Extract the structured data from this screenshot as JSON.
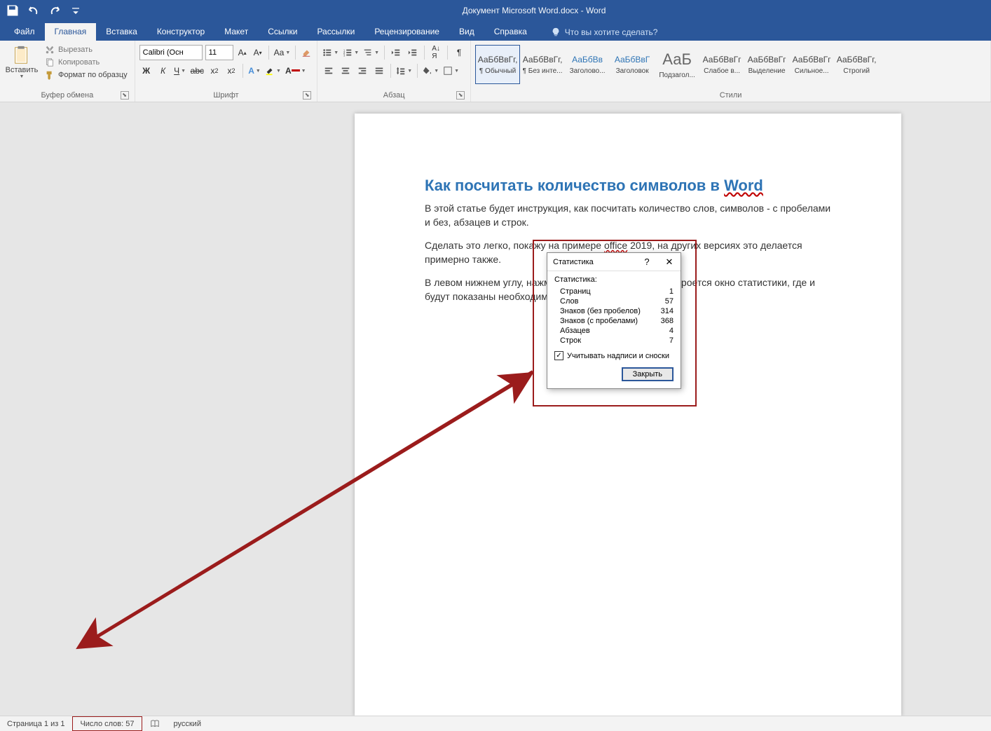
{
  "titlebar": {
    "title": "Документ Microsoft Word.docx  -  Word"
  },
  "tabs": {
    "file": "Файл",
    "items": [
      "Главная",
      "Вставка",
      "Конструктор",
      "Макет",
      "Ссылки",
      "Рассылки",
      "Рецензирование",
      "Вид",
      "Справка"
    ],
    "active": 0,
    "tell_me": "Что вы хотите сделать?"
  },
  "clipboard": {
    "paste": "Вставить",
    "cut": "Вырезать",
    "copy": "Копировать",
    "format_painter": "Формат по образцу",
    "label": "Буфер обмена"
  },
  "font": {
    "name": "Calibri (Осн",
    "size": "11",
    "label": "Шрифт"
  },
  "paragraph": {
    "label": "Абзац"
  },
  "styles": {
    "label": "Стили",
    "items": [
      {
        "preview": "АаБбВвГг,",
        "name": "¶ Обычный",
        "sel": true,
        "cls": ""
      },
      {
        "preview": "АаБбВвГг,",
        "name": "¶ Без инте...",
        "cls": ""
      },
      {
        "preview": "АаБбВв",
        "name": "Заголово...",
        "cls": "blue"
      },
      {
        "preview": "АаБбВвГ",
        "name": "Заголовок",
        "cls": "blue"
      },
      {
        "preview": "АаБ",
        "name": "Подзагол...",
        "cls": "big"
      },
      {
        "preview": "АаБбВвГг",
        "name": "Слабое в...",
        "cls": ""
      },
      {
        "preview": "АаБбВвГг",
        "name": "Выделение",
        "cls": ""
      },
      {
        "preview": "АаБбВвГг",
        "name": "Сильное...",
        "cls": ""
      },
      {
        "preview": "АаБбВвГг,",
        "name": "Строгий",
        "cls": ""
      }
    ]
  },
  "document": {
    "title_pre": "Как посчитать количество символов в ",
    "title_ul": "Word",
    "p1": "В этой статье будет инструкция, как посчитать количество слов, символов - с пробелами и без, абзацев и строк.",
    "p2_pre": "Сделать это легко, покажу на примере ",
    "p2_ul": "office",
    "p2_post": " 2019, на других версиях это делается примерно также.",
    "p3": "В левом нижнем углу, нажмите \"Кол-во слов\". Далее откроется окно статистики, где и будут показаны необходимые данные."
  },
  "dialog": {
    "title": "Статистика",
    "head": "Статистика:",
    "rows": [
      {
        "k": "Страниц",
        "v": "1"
      },
      {
        "k": "Слов",
        "v": "57"
      },
      {
        "k": "Знаков (без пробелов)",
        "v": "314"
      },
      {
        "k": "Знаков (с пробелами)",
        "v": "368"
      },
      {
        "k": "Абзацев",
        "v": "4"
      },
      {
        "k": "Строк",
        "v": "7"
      }
    ],
    "checkbox": "Учитывать надписи и сноски",
    "close": "Закрыть"
  },
  "statusbar": {
    "page": "Страница 1 из 1",
    "words": "Число слов: 57",
    "lang": "русский"
  }
}
